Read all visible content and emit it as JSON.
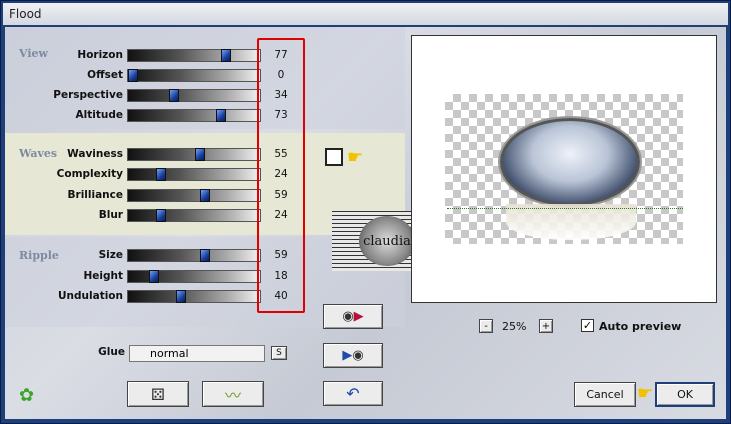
{
  "window": {
    "title": "Flood"
  },
  "groups": {
    "view": {
      "label": "View",
      "rows": [
        {
          "label": "Horizon",
          "value": 77
        },
        {
          "label": "Offset",
          "value": 0
        },
        {
          "label": "Perspective",
          "value": 34
        },
        {
          "label": "Altitude",
          "value": 73
        }
      ]
    },
    "waves": {
      "label": "Waves",
      "rows": [
        {
          "label": "Waviness",
          "value": 55
        },
        {
          "label": "Complexity",
          "value": 24
        },
        {
          "label": "Brilliance",
          "value": 59
        },
        {
          "label": "Blur",
          "value": 24
        }
      ]
    },
    "ripple": {
      "label": "Ripple",
      "rows": [
        {
          "label": "Size",
          "value": 59
        },
        {
          "label": "Height",
          "value": 18
        },
        {
          "label": "Undulation",
          "value": 40
        }
      ]
    }
  },
  "glue": {
    "label": "Glue",
    "value": "normal",
    "button": "S"
  },
  "preview": {
    "zoom_minus": "-",
    "zoom": "25%",
    "zoom_plus": "+",
    "auto_preview_label": "Auto preview",
    "auto_preview_checked": true
  },
  "watermark": {
    "text": "claudia"
  },
  "buttons": {
    "cancel": "Cancel",
    "ok": "OK"
  },
  "icons": [
    "flame-icon",
    "dice-icon",
    "wave-icon",
    "undo-icon",
    "play-to-disc-icon",
    "disc-to-play-icon",
    "pointing-hand-icon"
  ]
}
